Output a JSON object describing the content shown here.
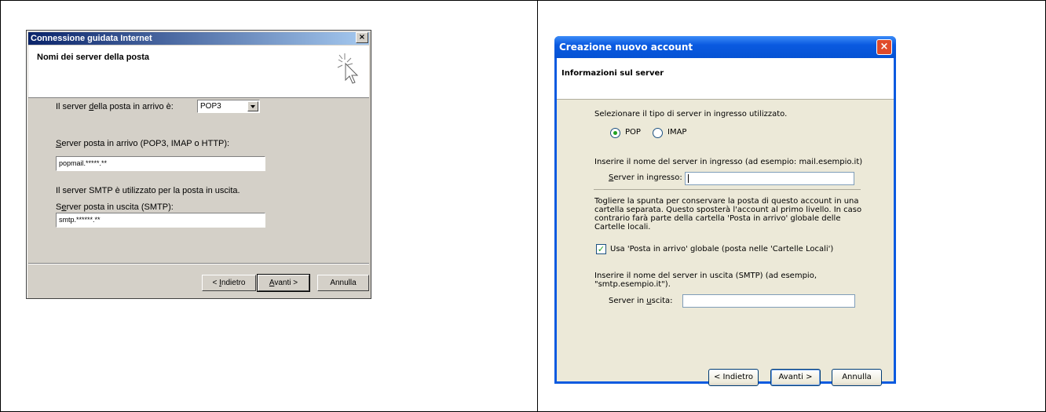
{
  "left_dialog": {
    "title": "Connessione guidata Internet",
    "close": "×",
    "header": "Nomi dei server della posta",
    "incoming_type_label_a": "Il server ",
    "incoming_type_label_u": "d",
    "incoming_type_label_b": "ella posta in arrivo è:",
    "incoming_type_value": "POP3",
    "incoming_server_label_u": "S",
    "incoming_server_label": "erver posta in arrivo (POP3, IMAP o HTTP):",
    "incoming_server_value": "popmail.*****.**",
    "smtp_note": "Il server SMTP è utilizzato per la posta in uscita.",
    "outgoing_label_a": "S",
    "outgoing_label_u": "e",
    "outgoing_label_b": "rver posta in uscita (SMTP):",
    "outgoing_value": "smtp.******.**",
    "back_a": "< ",
    "back_u": "I",
    "back_b": "ndietro",
    "next_u": "A",
    "next_b": "vanti >",
    "cancel": "Annulla"
  },
  "right_dialog": {
    "title": "Creazione nuovo account",
    "close": "×",
    "header": "Informazioni sul server",
    "select_type": "Selezionare il tipo di server in ingresso utilizzato.",
    "radio_pop": "POP",
    "radio_imap": "IMAP",
    "incoming_help": "Inserire il nome del server in ingresso (ad esempio: mail.esempio.it)",
    "incoming_label_u": "S",
    "incoming_label": "erver in ingresso:",
    "incoming_value": "",
    "global_help_1": "Togliere la spunta per conservare la posta di questo account in una",
    "global_help_2": "cartella separata. Questo sposterà l'account al primo livello. In caso",
    "global_help_3": "contrario farà parte della cartella 'Posta in arrivo' globale delle",
    "global_help_4": "Cartelle locali.",
    "global_checkbox": "Usa 'Posta in arrivo' globale (posta nelle 'Cartelle Locali')",
    "outgoing_help_1": "Inserire il nome del server in uscita (SMTP) (ad esempio,",
    "outgoing_help_2": "\"smtp.esempio.it\").",
    "outgoing_label_a": "Server in ",
    "outgoing_label_u": "u",
    "outgoing_label_b": "scita:",
    "outgoing_value": "",
    "back": "< Indietro",
    "next": "Avanti >",
    "cancel": "Annulla"
  }
}
